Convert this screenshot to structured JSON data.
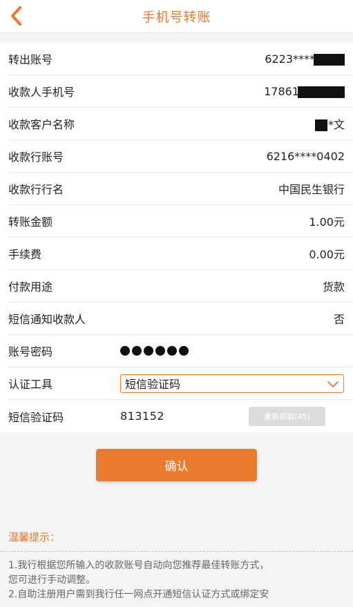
{
  "header": {
    "title": "手机号转账",
    "back_icon": "chevron-left-icon",
    "accent": "#e8792d"
  },
  "form": {
    "rows": [
      {
        "label": "转出账号",
        "value": "6223****"
      },
      {
        "label": "收款人手机号",
        "value": "17861"
      },
      {
        "label": "收款客户名称",
        "value": "*文"
      },
      {
        "label": "收款行账号",
        "value": "6216****0402"
      },
      {
        "label": "收款行行名",
        "value": "中国民生银行"
      },
      {
        "label": "转账金额",
        "value": "1.00元"
      },
      {
        "label": "手续费",
        "value": "0.00元"
      },
      {
        "label": "付款用途",
        "value": "货款"
      },
      {
        "label": "短信通知收款人",
        "value": "否"
      }
    ],
    "password": {
      "label": "账号密码",
      "dot_count": 6
    },
    "auth_tool": {
      "label": "认证工具",
      "selected": "短信验证码"
    },
    "sms_code": {
      "label": "短信验证码",
      "value": "813152",
      "resend_label": "重新获取(45)"
    }
  },
  "confirm_label": "确认",
  "tips": {
    "title": "温馨提示：",
    "line1": "1.我行根据您所输入的收款账号自动向您推荐最佳转账方式，",
    "line2": "您可进行手动调整。",
    "line3": "2.自助注册用户需到我行任一网点开通短信认证方式或绑定安"
  }
}
